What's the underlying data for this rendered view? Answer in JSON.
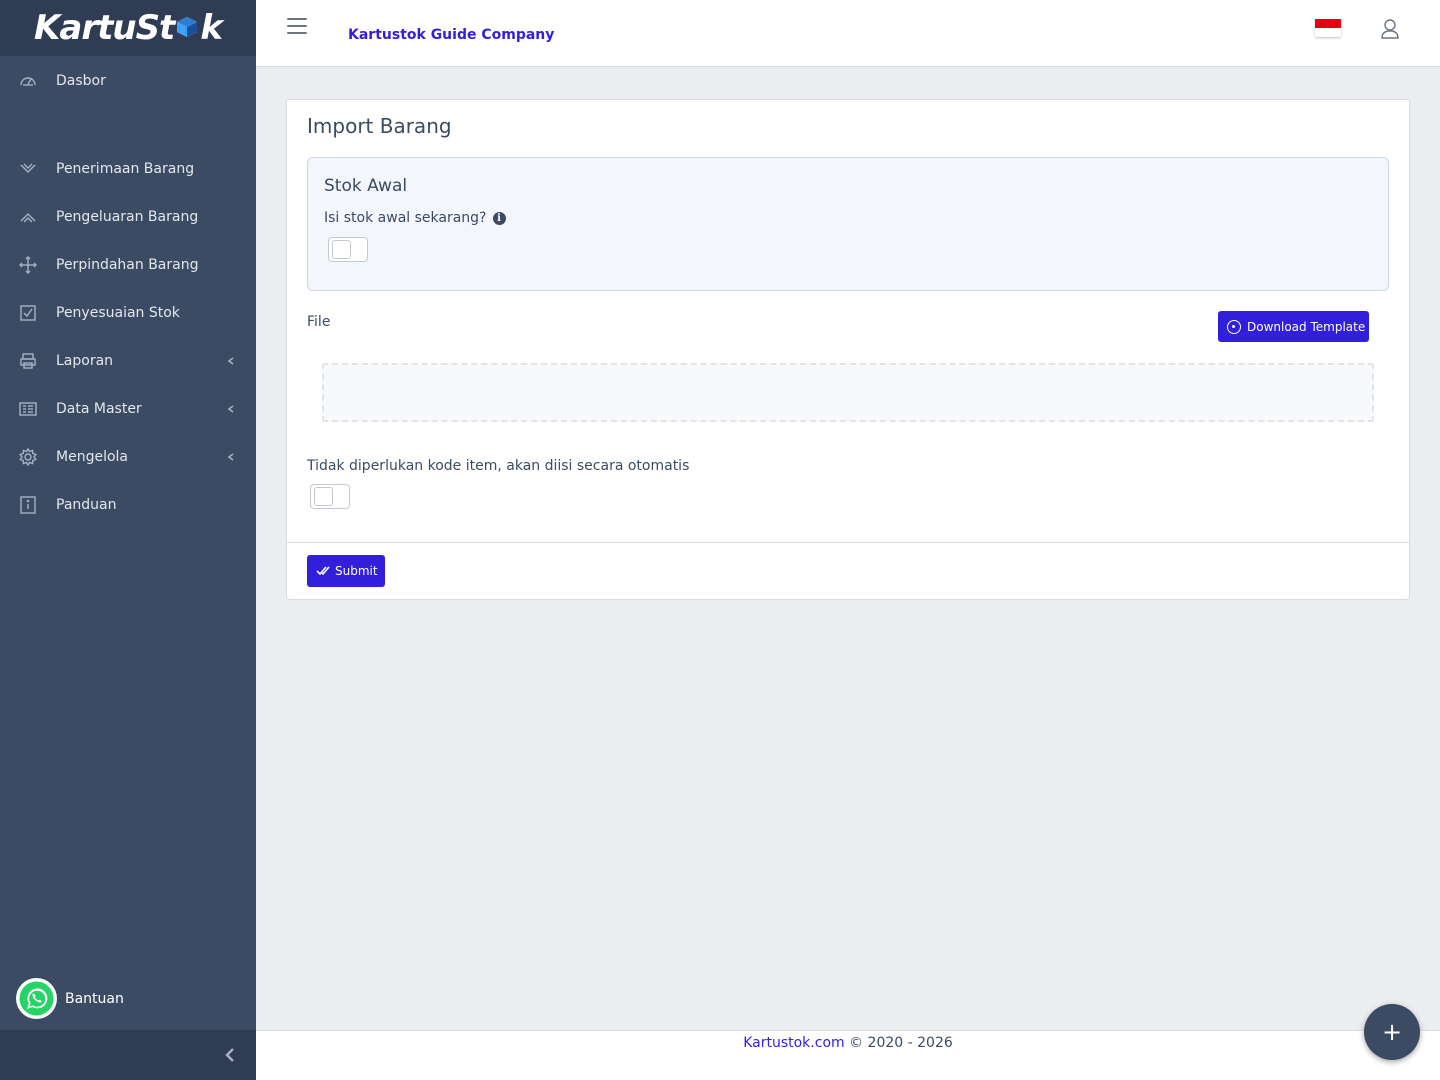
{
  "brand": {
    "logo_text_1": "KartuSt",
    "logo_text_2": "k"
  },
  "sidebar": {
    "items": [
      {
        "label": "Dasbor",
        "icon": "speedometer-icon"
      },
      {
        "label": "Penerimaan Barang",
        "icon": "chevron-down-icon"
      },
      {
        "label": "Pengeluaran Barang",
        "icon": "chevron-up-icon"
      },
      {
        "label": "Perpindahan Barang",
        "icon": "move-icon"
      },
      {
        "label": "Penyesuaian Stok",
        "icon": "checkbox-icon"
      },
      {
        "label": "Laporan",
        "icon": "printer-icon",
        "expandable": true
      },
      {
        "label": "Data Master",
        "icon": "list-icon",
        "expandable": true
      },
      {
        "label": "Mengelola",
        "icon": "gear-icon",
        "expandable": true
      },
      {
        "label": "Panduan",
        "icon": "info-icon"
      }
    ],
    "help_label": "Bantuan"
  },
  "header": {
    "company": "Kartustok Guide Company",
    "language_flag": "indonesia-flag",
    "user_icon": "user-icon"
  },
  "card": {
    "title": "Import Barang",
    "stok_awal": {
      "title": "Stok Awal",
      "question": "Isi stok awal sekarang?",
      "toggle_on": false
    },
    "file_label": "File",
    "download_label": "Download Template",
    "auto_code_label": "Tidak diperlukan kode item, akan diisi secara otomatis",
    "auto_code_toggle_on": false,
    "submit_label": "Submit"
  },
  "footer": {
    "link_text": "Kartustok.com",
    "copyright": " © 2020 - 2026"
  },
  "colors": {
    "sidebar": "#3c4b64",
    "sidebar_dark": "#303c54",
    "primary": "#321fdb",
    "background": "#ebedf0"
  }
}
